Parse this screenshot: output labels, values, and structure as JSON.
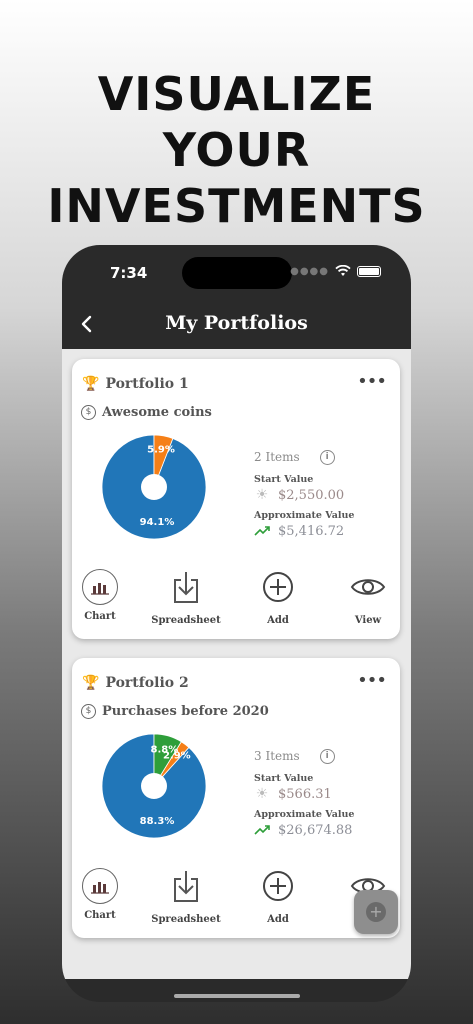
{
  "headline": [
    "VISUALIZE",
    "YOUR",
    "INVESTMENTS"
  ],
  "status_bar": {
    "time": "7:34"
  },
  "nav": {
    "title": "My Portfolios",
    "back_icon": "chevron-left-icon"
  },
  "colors": {
    "pie_blue": "#2176b8",
    "pie_orange": "#f57f17",
    "pie_green": "#2e9e3a"
  },
  "portfolios": [
    {
      "name": "Portfolio 1",
      "subtitle": "Awesome coins",
      "items_count": "2 Items",
      "start_label": "Start Value",
      "start_value": "$2,550.00",
      "approx_label": "Approximate Value",
      "approx_value": "$5,416.72",
      "pie_slices": [
        {
          "label": "94.1%",
          "value": 94.1,
          "color": "#2176b8"
        },
        {
          "label": "5.9%",
          "value": 5.9,
          "color": "#f57f17"
        }
      ],
      "actions": {
        "chart": "Chart",
        "spreadsheet": "Spreadsheet",
        "add": "Add",
        "view": "View"
      }
    },
    {
      "name": "Portfolio 2",
      "subtitle": "Purchases before 2020",
      "items_count": "3 Items",
      "start_label": "Start Value",
      "start_value": "$566.31",
      "approx_label": "Approximate Value",
      "approx_value": "$26,674.88",
      "pie_slices": [
        {
          "label": "88.3%",
          "value": 88.3,
          "color": "#2176b8"
        },
        {
          "label": "2.9%",
          "value": 2.9,
          "color": "#f57f17"
        },
        {
          "label": "8.8%",
          "value": 8.8,
          "color": "#2e9e3a"
        }
      ],
      "actions": {
        "chart": "Chart",
        "spreadsheet": "Spreadsheet",
        "add": "Add",
        "view": "View"
      }
    }
  ]
}
